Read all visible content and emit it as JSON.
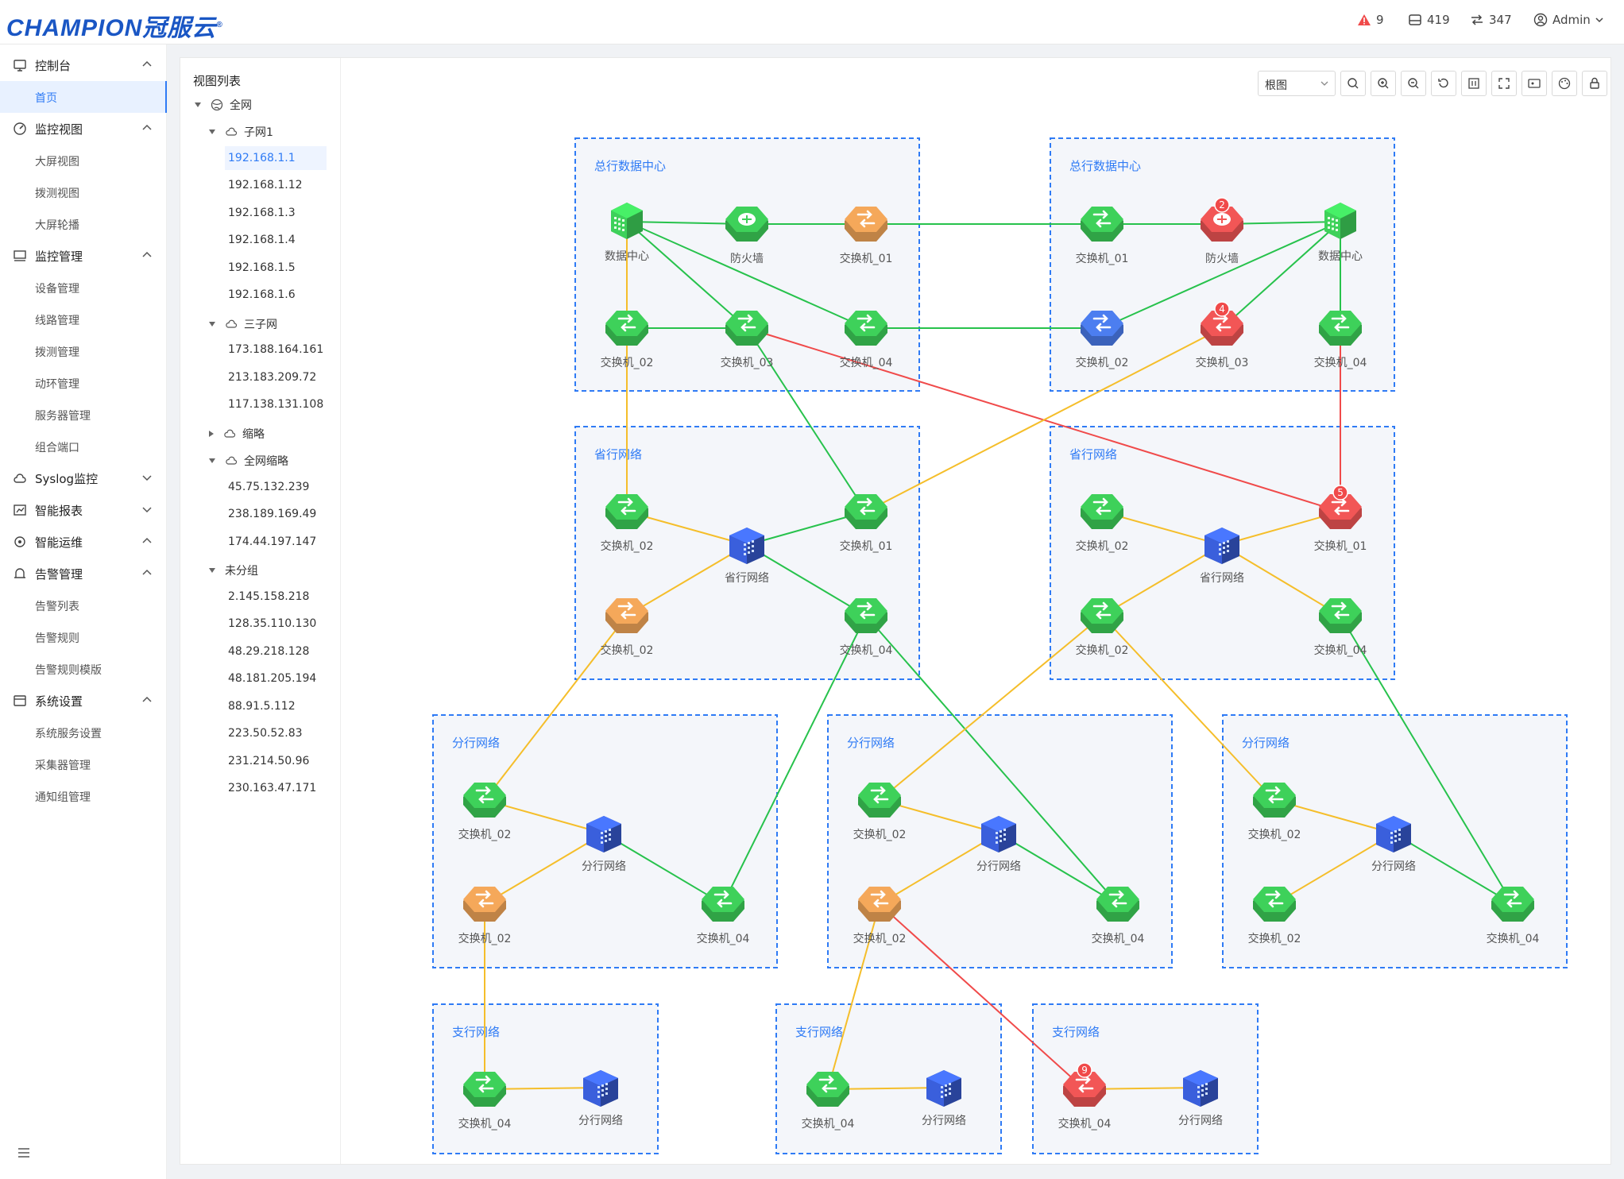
{
  "header": {
    "logo": "CHAMPION冠服云",
    "logo_mark": "®",
    "alerts": "9",
    "devices": "419",
    "links": "347",
    "user": "Admin"
  },
  "sidebar": {
    "groups": [
      {
        "label": "控制台",
        "icon": "monitor-icon",
        "expanded": true,
        "items": [
          "首页"
        ]
      },
      {
        "label": "监控视图",
        "icon": "dashboard-icon",
        "expanded": true,
        "items": [
          "大屏视图",
          "拨测视图",
          "大屏轮播"
        ]
      },
      {
        "label": "监控管理",
        "icon": "device-monitor-icon",
        "expanded": true,
        "items": [
          "设备管理",
          "线路管理",
          "拨测管理",
          "动环管理",
          "服务器管理",
          "组合端口"
        ]
      },
      {
        "label": "Syslog监控",
        "icon": "cloud-icon",
        "expanded": false,
        "items": []
      },
      {
        "label": "智能报表",
        "icon": "report-icon",
        "expanded": false,
        "items": []
      },
      {
        "label": "智能运维",
        "icon": "ops-icon",
        "expanded": true,
        "items": []
      },
      {
        "label": "告警管理",
        "icon": "alarm-icon",
        "expanded": true,
        "items": [
          "告警列表",
          "告警规则",
          "告警规则模版"
        ]
      },
      {
        "label": "系统设置",
        "icon": "settings-icon",
        "expanded": true,
        "items": [
          "系统服务设置",
          "采集器管理",
          "通知组管理"
        ]
      }
    ],
    "active_item": "首页",
    "collapse_icon": "menu-icon"
  },
  "tree": {
    "title": "视图列表",
    "root": "全网",
    "subnets": [
      {
        "name": "子网1",
        "expanded": true,
        "ips": [
          "192.168.1.1",
          "192.168.1.12",
          "192.168.1.3",
          "192.168.1.4",
          "192.168.1.5",
          "192.168.1.6"
        ]
      },
      {
        "name": "三子网",
        "expanded": true,
        "ips": [
          "173.188.164.161",
          "213.183.209.72",
          "117.138.131.108"
        ]
      },
      {
        "name": "缩略",
        "expanded": false,
        "ips": []
      },
      {
        "name": "全网缩略",
        "expanded": true,
        "ips": [
          "45.75.132.239",
          "238.189.169.49",
          "174.44.197.147"
        ]
      },
      {
        "name": "未分组",
        "expanded": true,
        "ips": [
          "2.145.158.218",
          "128.35.110.130",
          "48.29.218.128",
          "48.181.205.194",
          "88.91.5.112",
          "223.50.52.83",
          "231.214.50.96",
          "230.163.47.171"
        ]
      }
    ],
    "selected": "192.168.1.1"
  },
  "toolbar": {
    "view_select": "根图",
    "buttons": [
      "search-icon",
      "zoom-in-icon",
      "zoom-out-icon",
      "refresh-icon",
      "grid-icon",
      "fullscreen-icon",
      "image-icon",
      "palette-icon",
      "lock-icon"
    ]
  },
  "topology": {
    "groups": [
      {
        "id": "g1",
        "title": "总行数据中心"
      },
      {
        "id": "g2",
        "title": "总行数据中心"
      },
      {
        "id": "g3",
        "title": "省行网络"
      },
      {
        "id": "g4",
        "title": "省行网络"
      },
      {
        "id": "g5",
        "title": "分行网络"
      },
      {
        "id": "g6",
        "title": "分行网络"
      },
      {
        "id": "g7",
        "title": "分行网络"
      },
      {
        "id": "g8",
        "title": "支行网络"
      },
      {
        "id": "g9",
        "title": "支行网络"
      },
      {
        "id": "g10",
        "title": "支行网络"
      }
    ],
    "nodes": [
      {
        "id": "a1",
        "label": "数据中心",
        "type": "server",
        "status": "ok"
      },
      {
        "id": "a2",
        "label": "防火墙",
        "type": "firewall",
        "status": "ok"
      },
      {
        "id": "a3",
        "label": "交换机_01",
        "type": "switch",
        "status": "warn"
      },
      {
        "id": "a4",
        "label": "交换机_02",
        "type": "switch",
        "status": "ok"
      },
      {
        "id": "a5",
        "label": "交换机_03",
        "type": "switch",
        "status": "ok"
      },
      {
        "id": "a6",
        "label": "交换机_04",
        "type": "switch",
        "status": "ok"
      },
      {
        "id": "b1",
        "label": "交换机_01",
        "type": "switch",
        "status": "ok"
      },
      {
        "id": "b2",
        "label": "防火墙",
        "type": "firewall",
        "status": "alarm",
        "badge": "2"
      },
      {
        "id": "b3",
        "label": "数据中心",
        "type": "server",
        "status": "ok"
      },
      {
        "id": "b4",
        "label": "交换机_02",
        "type": "switch",
        "status": "info"
      },
      {
        "id": "b5",
        "label": "交换机_03",
        "type": "switch",
        "status": "alarm",
        "badge": "4"
      },
      {
        "id": "b6",
        "label": "交换机_04",
        "type": "switch",
        "status": "ok"
      },
      {
        "id": "c1",
        "label": "交换机_02",
        "type": "switch",
        "status": "ok"
      },
      {
        "id": "c2",
        "label": "交换机_01",
        "type": "switch",
        "status": "ok"
      },
      {
        "id": "c3",
        "label": "省行网络",
        "type": "building",
        "status": "ok"
      },
      {
        "id": "c4",
        "label": "交换机_02",
        "type": "switch",
        "status": "warn"
      },
      {
        "id": "c5",
        "label": "交换机_04",
        "type": "switch",
        "status": "ok"
      },
      {
        "id": "d1",
        "label": "交换机_02",
        "type": "switch",
        "status": "ok"
      },
      {
        "id": "d2",
        "label": "交换机_01",
        "type": "switch",
        "status": "alarm",
        "badge": "5"
      },
      {
        "id": "d3",
        "label": "省行网络",
        "type": "building",
        "status": "ok"
      },
      {
        "id": "d4",
        "label": "交换机_02",
        "type": "switch",
        "status": "ok"
      },
      {
        "id": "d5",
        "label": "交换机_04",
        "type": "switch",
        "status": "ok"
      },
      {
        "id": "e1",
        "label": "交换机_02",
        "type": "switch",
        "status": "ok"
      },
      {
        "id": "e2",
        "label": "分行网络",
        "type": "building",
        "status": "ok"
      },
      {
        "id": "e3",
        "label": "交换机_02",
        "type": "switch",
        "status": "warn"
      },
      {
        "id": "e4",
        "label": "交换机_04",
        "type": "switch",
        "status": "ok"
      },
      {
        "id": "f1",
        "label": "交换机_02",
        "type": "switch",
        "status": "ok"
      },
      {
        "id": "f2",
        "label": "分行网络",
        "type": "building",
        "status": "ok"
      },
      {
        "id": "f3",
        "label": "交换机_02",
        "type": "switch",
        "status": "warn"
      },
      {
        "id": "f4",
        "label": "交换机_04",
        "type": "switch",
        "status": "ok"
      },
      {
        "id": "h1",
        "label": "交换机_02",
        "type": "switch",
        "status": "ok"
      },
      {
        "id": "h2",
        "label": "分行网络",
        "type": "building",
        "status": "ok"
      },
      {
        "id": "h3",
        "label": "交换机_02",
        "type": "switch",
        "status": "ok"
      },
      {
        "id": "h4",
        "label": "交换机_04",
        "type": "switch",
        "status": "ok"
      },
      {
        "id": "i1",
        "label": "交换机_04",
        "type": "switch",
        "status": "ok"
      },
      {
        "id": "i2",
        "label": "分行网络",
        "type": "building",
        "status": "ok"
      },
      {
        "id": "j1",
        "label": "交换机_04",
        "type": "switch",
        "status": "ok"
      },
      {
        "id": "j2",
        "label": "分行网络",
        "type": "building",
        "status": "ok"
      },
      {
        "id": "k1",
        "label": "交换机_04",
        "type": "switch",
        "status": "alarm",
        "badge": "9"
      },
      {
        "id": "k2",
        "label": "分行网络",
        "type": "building",
        "status": "ok"
      }
    ],
    "links": [
      [
        "a1",
        "a2",
        "green"
      ],
      [
        "a2",
        "a3",
        "green"
      ],
      [
        "a3",
        "b1",
        "green"
      ],
      [
        "b1",
        "b2",
        "green"
      ],
      [
        "b2",
        "b3",
        "green"
      ],
      [
        "a1",
        "a5",
        "green"
      ],
      [
        "a1",
        "a6",
        "green"
      ],
      [
        "a4",
        "a5",
        "green"
      ],
      [
        "a6",
        "b4",
        "green"
      ],
      [
        "b3",
        "b4",
        "green"
      ],
      [
        "b3",
        "b5",
        "green"
      ],
      [
        "b3",
        "b6",
        "green"
      ],
      [
        "a1",
        "a4",
        "yellow"
      ],
      [
        "a4",
        "c1",
        "yellow"
      ],
      [
        "a5",
        "c2",
        "green"
      ],
      [
        "a5",
        "d2",
        "red"
      ],
      [
        "b5",
        "c2",
        "yellow"
      ],
      [
        "b6",
        "d2",
        "red"
      ],
      [
        "c1",
        "c3",
        "yellow"
      ],
      [
        "c2",
        "c3",
        "green"
      ],
      [
        "c4",
        "c3",
        "yellow"
      ],
      [
        "c3",
        "c5",
        "green"
      ],
      [
        "d1",
        "d3",
        "yellow"
      ],
      [
        "d3",
        "d2",
        "yellow"
      ],
      [
        "d4",
        "d3",
        "yellow"
      ],
      [
        "d3",
        "d5",
        "yellow"
      ],
      [
        "c4",
        "e1",
        "yellow"
      ],
      [
        "c5",
        "e4",
        "green"
      ],
      [
        "c5",
        "f4",
        "green"
      ],
      [
        "d4",
        "f1",
        "yellow"
      ],
      [
        "d4",
        "h1",
        "yellow"
      ],
      [
        "d5",
        "h4",
        "green"
      ],
      [
        "e1",
        "e2",
        "yellow"
      ],
      [
        "e2",
        "e4",
        "green"
      ],
      [
        "e3",
        "e2",
        "yellow"
      ],
      [
        "f1",
        "f2",
        "yellow"
      ],
      [
        "f2",
        "f4",
        "green"
      ],
      [
        "f3",
        "f2",
        "yellow"
      ],
      [
        "h1",
        "h2",
        "yellow"
      ],
      [
        "h2",
        "h4",
        "green"
      ],
      [
        "h3",
        "h2",
        "yellow"
      ],
      [
        "e3",
        "i1",
        "yellow"
      ],
      [
        "i1",
        "i2",
        "yellow"
      ],
      [
        "f3",
        "j1",
        "yellow"
      ],
      [
        "j1",
        "j2",
        "yellow"
      ],
      [
        "f3",
        "k1",
        "red"
      ],
      [
        "k1",
        "k2",
        "yellow"
      ]
    ]
  },
  "colors": {
    "accent": "#2f7bf5",
    "green_link": "#27c24c",
    "yellow_link": "#f5be2a",
    "red_link": "#f04a4a",
    "ok": "#3ed15a",
    "warn": "#f5a85a",
    "alarm": "#f25656",
    "info": "#4c7ef0",
    "building": "#3a5fdc"
  }
}
